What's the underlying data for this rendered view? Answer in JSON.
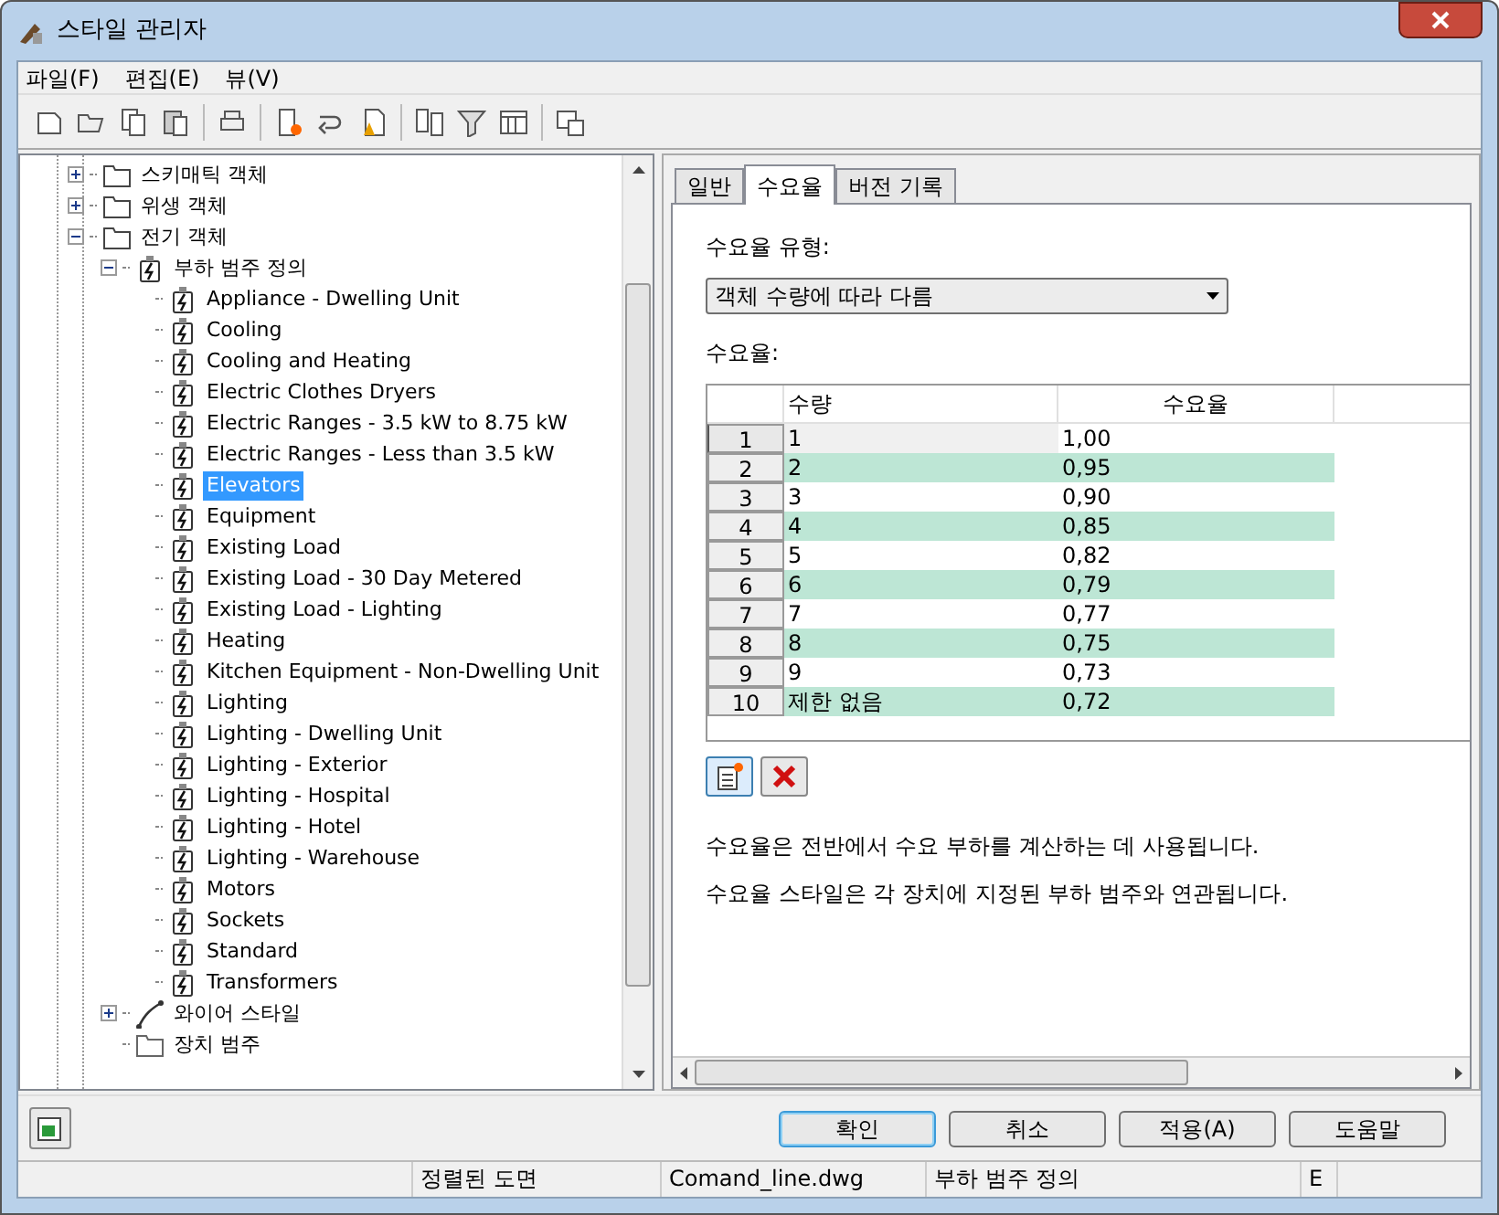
{
  "window": {
    "title": "스타일 관리자"
  },
  "menu": [
    "파일(F)",
    "편집(E)",
    "뷰(V)"
  ],
  "tree": [
    {
      "kind": "folder",
      "label": "스키매틱 객체",
      "expanded": false,
      "selected": false
    },
    {
      "kind": "folder",
      "label": "위생 객체",
      "expanded": false,
      "selected": false
    },
    {
      "kind": "folder",
      "label": "전기 객체",
      "expanded": true,
      "selected": false,
      "children": [
        {
          "kind": "category",
          "label": "부하 범주 정의",
          "expanded": true,
          "selected": false,
          "children": [
            {
              "kind": "load",
              "label": "Appliance - Dwelling Unit",
              "selected": false
            },
            {
              "kind": "load",
              "label": "Cooling",
              "selected": false
            },
            {
              "kind": "load",
              "label": "Cooling and Heating",
              "selected": false
            },
            {
              "kind": "load",
              "label": "Electric Clothes Dryers",
              "selected": false
            },
            {
              "kind": "load",
              "label": "Electric Ranges - 3.5 kW to 8.75 kW",
              "selected": false
            },
            {
              "kind": "load",
              "label": "Electric Ranges - Less than 3.5 kW",
              "selected": false
            },
            {
              "kind": "load",
              "label": "Elevators",
              "selected": true
            },
            {
              "kind": "load",
              "label": "Equipment",
              "selected": false
            },
            {
              "kind": "load",
              "label": "Existing Load",
              "selected": false
            },
            {
              "kind": "load",
              "label": "Existing Load - 30 Day Metered",
              "selected": false
            },
            {
              "kind": "load",
              "label": "Existing Load - Lighting",
              "selected": false
            },
            {
              "kind": "load",
              "label": "Heating",
              "selected": false
            },
            {
              "kind": "load",
              "label": "Kitchen Equipment - Non-Dwelling Unit",
              "selected": false
            },
            {
              "kind": "load",
              "label": "Lighting",
              "selected": false
            },
            {
              "kind": "load",
              "label": "Lighting - Dwelling Unit",
              "selected": false
            },
            {
              "kind": "load",
              "label": "Lighting - Exterior",
              "selected": false
            },
            {
              "kind": "load",
              "label": "Lighting - Hospital",
              "selected": false
            },
            {
              "kind": "load",
              "label": "Lighting - Hotel",
              "selected": false
            },
            {
              "kind": "load",
              "label": "Lighting - Warehouse",
              "selected": false
            },
            {
              "kind": "load",
              "label": "Motors",
              "selected": false
            },
            {
              "kind": "load",
              "label": "Sockets",
              "selected": false
            },
            {
              "kind": "load",
              "label": "Standard",
              "selected": false
            },
            {
              "kind": "load",
              "label": "Transformers",
              "selected": false
            }
          ]
        },
        {
          "kind": "wire",
          "label": "와이어 스타일",
          "expanded": false,
          "selected": false
        },
        {
          "kind": "device",
          "label": "장치 범주",
          "selected": false
        }
      ]
    }
  ],
  "tabs": [
    {
      "label": "일반",
      "selected": false
    },
    {
      "label": "수요율",
      "selected": true
    },
    {
      "label": "버전 기록",
      "selected": false
    }
  ],
  "demand_type": {
    "label": "수요율 유형:",
    "value": "객체 수량에 따라 다름"
  },
  "table": {
    "label": "수요율:",
    "columns": [
      "수량",
      "수요율"
    ],
    "rows": [
      {
        "index": "1",
        "quantity": "1",
        "factor": "1,00",
        "selected": true
      },
      {
        "index": "2",
        "quantity": "2",
        "factor": "0,95",
        "selected": false
      },
      {
        "index": "3",
        "quantity": "3",
        "factor": "0,90",
        "selected": false
      },
      {
        "index": "4",
        "quantity": "4",
        "factor": "0,85",
        "selected": false
      },
      {
        "index": "5",
        "quantity": "5",
        "factor": "0,82",
        "selected": false
      },
      {
        "index": "6",
        "quantity": "6",
        "factor": "0,79",
        "selected": false
      },
      {
        "index": "7",
        "quantity": "7",
        "factor": "0,77",
        "selected": false
      },
      {
        "index": "8",
        "quantity": "8",
        "factor": "0,75",
        "selected": false
      },
      {
        "index": "9",
        "quantity": "9",
        "factor": "0,73",
        "selected": false
      },
      {
        "index": "10",
        "quantity": "제한 없음",
        "factor": "0,72",
        "selected": false
      }
    ]
  },
  "description": [
    "수요율은 전반에서 수요 부하를 계산하는 데 사용됩니다.",
    "수요율 스타일은 각 장치에 지정된 부하 범주와 연관됩니다."
  ],
  "buttons": [
    {
      "label": "확인",
      "default": true
    },
    {
      "label": "취소",
      "default": false
    },
    {
      "label": "적용(A)",
      "default": false
    },
    {
      "label": "도움말",
      "default": false
    }
  ],
  "status_bar": [
    "정렬된 도면",
    "Comand_line.dwg",
    "부하 범주 정의",
    "E"
  ]
}
